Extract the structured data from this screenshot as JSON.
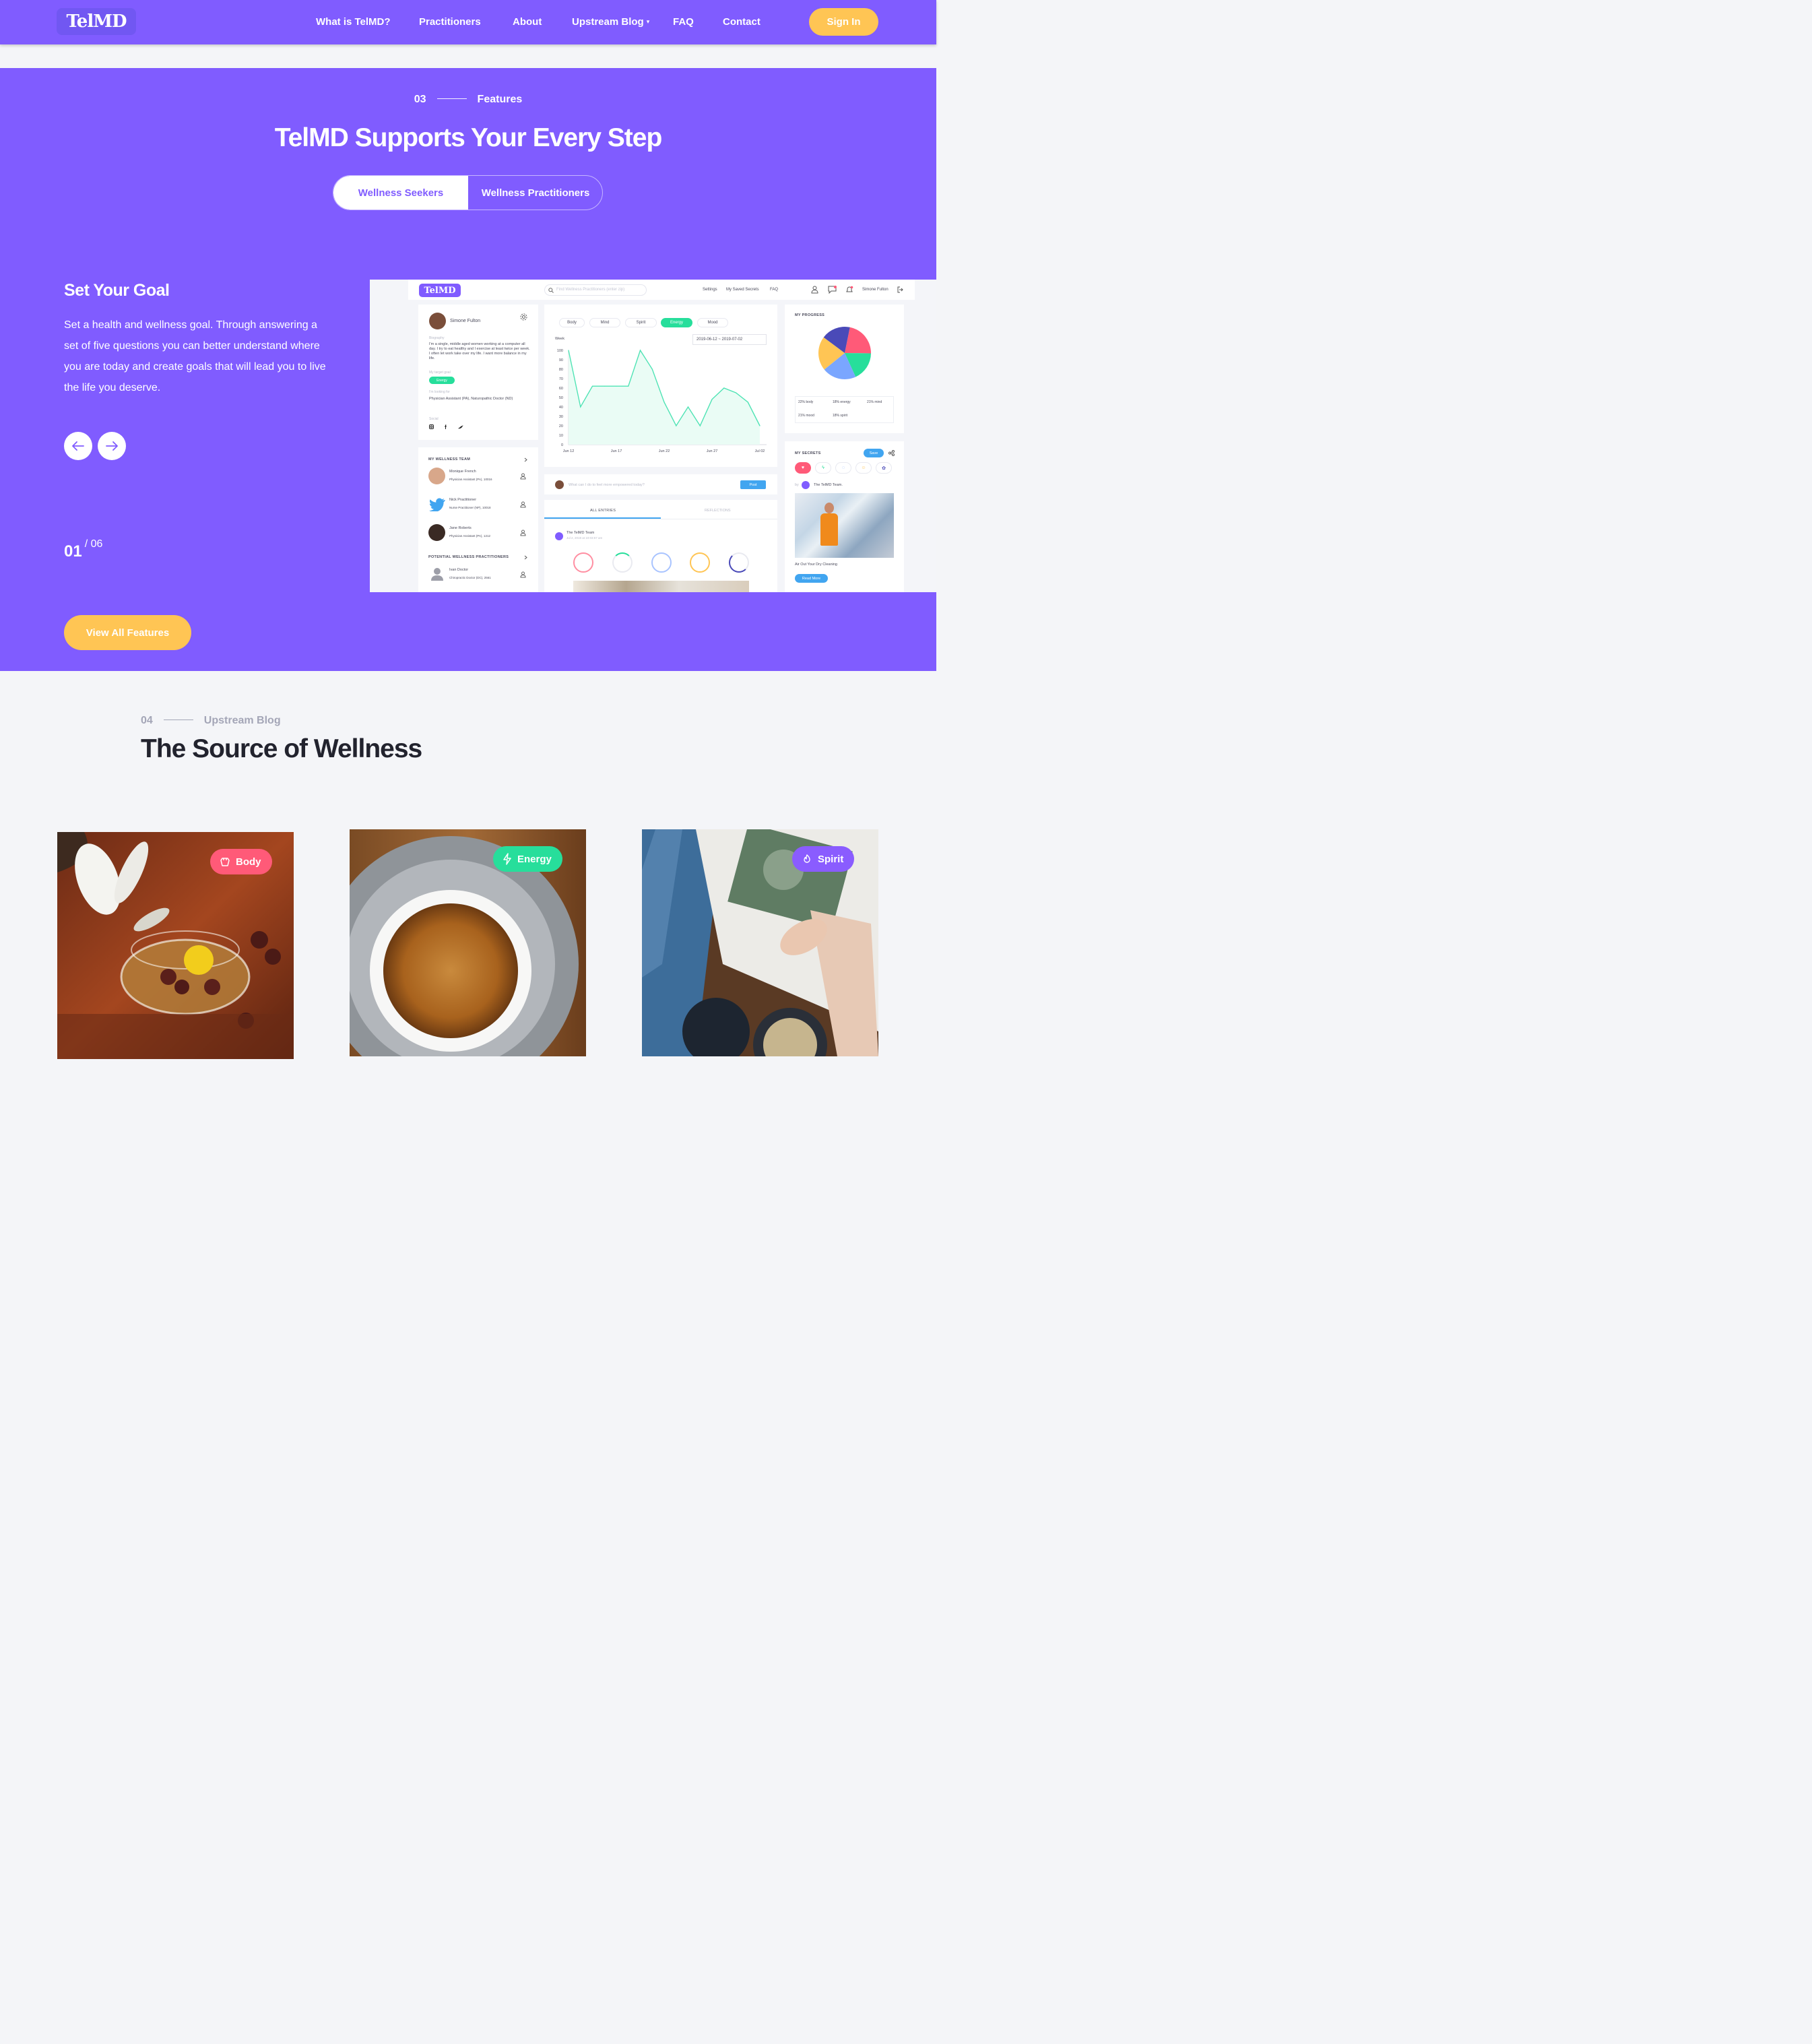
{
  "brand": {
    "logo": "TelMD"
  },
  "nav": {
    "links": [
      "What is TelMD?",
      "Practitioners",
      "About",
      "Upstream Blog",
      "FAQ",
      "Contact"
    ],
    "dropdown_caret": "▾",
    "signin": "Sign In"
  },
  "features": {
    "number": "03",
    "label": "Features",
    "title": "TelMD Supports Your Every Step",
    "tabs": [
      "Wellness Seekers",
      "Wellness Practitioners"
    ],
    "active_tab": "Wellness Seekers",
    "slide": {
      "title": "Set Your Goal",
      "text": "Set a health and wellness goal. Through answering a set of five questions you can better understand where you are today and create goals that will lead you to live the life you deserve.",
      "current": "01",
      "total": "/ 06"
    },
    "view_all": "View All Features"
  },
  "app_screenshot": {
    "logo": "TelMD",
    "search_placeholder": "Find Wellness Practitioners (enter zip)",
    "top_links": [
      "Settings",
      "My Saved Secrets",
      "FAQ"
    ],
    "user": "Simone Fulton",
    "profile": {
      "name": "Simone Fulton",
      "biography_label": "Biography",
      "biography": "I'm a single, middle aged women working at a computer all day. I try to eat healthy and I exercise at least twice per week. I often let work take over my life. I want more balance in my life.",
      "target_label": "My target goal",
      "target": "Energy",
      "looking_label": "I'm looking for",
      "looking": "Physician Assistant (PA), Naturopathic Doctor (ND)",
      "social_label": "Social"
    },
    "team": {
      "title": "MY WELLNESS TEAM",
      "members": [
        {
          "name": "Monique French",
          "role": "Physician Assistant (PA), 10016"
        },
        {
          "name": "Nick Practitioner",
          "role": "Nurse Practitioner (NP), 10018"
        },
        {
          "name": "Jane Roberts",
          "role": "Physician Assistant (PA), 1212"
        }
      ],
      "potential_title": "POTENTIAL WELLNESS PRACTITIONERS",
      "potential": [
        {
          "name": "Ivan Doctor",
          "role": "Chiropractic Doctor (DC), 2561"
        }
      ]
    },
    "chart_filters": [
      "Body",
      "Mind",
      "Spirit",
      "Energy",
      "Mood"
    ],
    "active_filter": "Energy",
    "period": "Week",
    "date_range": "2019-06-12 ~ 2019-07-02",
    "post_placeholder": "What can I do to feel more empowered today?",
    "post_button": "Post",
    "entry_tabs": [
      "ALL ENTRIES",
      "REFLECTIONS"
    ],
    "entry_author": "The TelMD Team",
    "entry_date": "Jul 2, 2019 at 10:03:57 am",
    "progress": {
      "title": "MY PROGRESS",
      "legend": [
        "22% body",
        "18% energy",
        "21% mind",
        "21% mood",
        "18% spirit"
      ]
    },
    "secrets": {
      "title": "MY SECRETS",
      "save": "Save",
      "by": "by",
      "author": "The TelMD Team.",
      "caption": "Air Out Your Dry Cleaning",
      "read_more": "Read More"
    }
  },
  "chart_data": {
    "type": "line",
    "series": [
      {
        "x": [
          "Jun 12",
          "Jun 13",
          "Jun 14",
          "Jun 15",
          "Jun 16",
          "Jun 17",
          "Jun 18",
          "Jun 19",
          "Jun 20",
          "Jun 21",
          "Jun 22",
          "Jun 23",
          "Jun 24",
          "Jun 25",
          "Jun 26",
          "Jun 27",
          "Jul 02"
        ],
        "values": [
          100,
          40,
          62,
          62,
          62,
          62,
          100,
          80,
          45,
          20,
          40,
          20,
          48,
          60,
          55,
          45,
          20
        ]
      }
    ],
    "x_ticks": [
      "Jun 12",
      "Jun 17",
      "Jun 22",
      "Jun 27",
      "Jul 02"
    ],
    "y_ticks": [
      100,
      90,
      80,
      70,
      60,
      50,
      40,
      30,
      20,
      10,
      0
    ],
    "ylim": [
      0,
      100
    ],
    "color": "#4fe3b4"
  },
  "pie_data": {
    "type": "pie",
    "labels": [
      "body",
      "energy",
      "mind",
      "mood",
      "spirit"
    ],
    "values": [
      22,
      18,
      21,
      21,
      18
    ],
    "colors": [
      "#ff5a78",
      "#27de9b",
      "#7aa6ff",
      "#ffc554",
      "#4a4ab8"
    ]
  },
  "blog": {
    "number": "04",
    "label": "Upstream Blog",
    "title": "The Source of Wellness",
    "cards": [
      {
        "badge": "Body",
        "color": "#ff5a78"
      },
      {
        "badge": "Energy",
        "color": "#27de9b"
      },
      {
        "badge": "Spirit",
        "color": "#8a5cff"
      }
    ]
  },
  "colors": {
    "primary": "#805cff",
    "accent": "#ffc554"
  }
}
